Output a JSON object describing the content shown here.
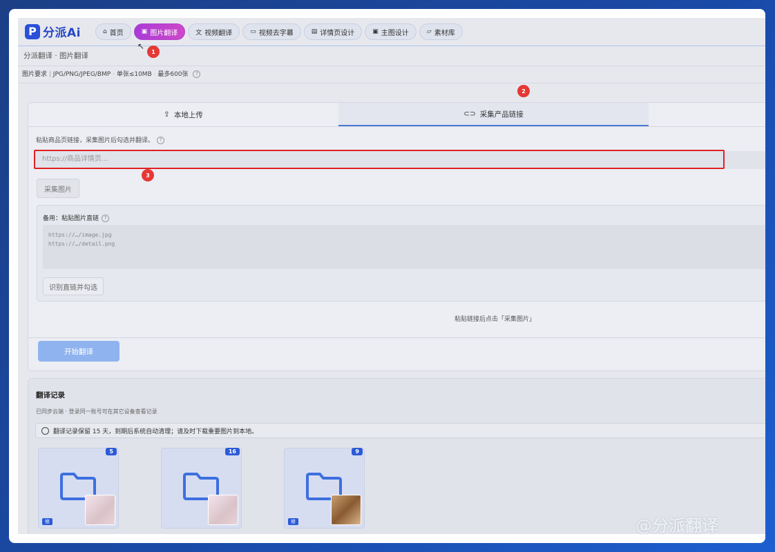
{
  "app": {
    "logo_text": "分派Ai"
  },
  "nav": {
    "tabs": [
      {
        "label": "首页",
        "icon": "home-icon"
      },
      {
        "label": "图片翻译",
        "icon": "image-icon",
        "active": true
      },
      {
        "label": "视频翻译",
        "icon": "translate-icon"
      },
      {
        "label": "视频去字幕",
        "icon": "subtitle-icon"
      },
      {
        "label": "详情页设计",
        "icon": "layout-icon"
      },
      {
        "label": "主图设计",
        "icon": "image-icon"
      },
      {
        "label": "素材库",
        "icon": "folder-icon"
      }
    ]
  },
  "breadcrumb": "分派翻译 · 图片翻译",
  "requirements": {
    "label": "图片要求",
    "formats": "JPG/PNG/JPEG/BMP",
    "size": "单张≤10MB",
    "count": "最多600张"
  },
  "upload_tabs": [
    {
      "label": "本地上传",
      "icon": "upload-icon"
    },
    {
      "label": "采集产品链接",
      "icon": "link-icon",
      "active": true
    }
  ],
  "link_form": {
    "hint": "粘贴商品页链接，采集图片后勾选并翻译。",
    "url_placeholder": "https://商品详情页...",
    "collect_button": "采集图片",
    "backup_label": "备用：粘贴图片直链",
    "backup_placeholder_line1": "https://…/image.jpg",
    "backup_placeholder_line2": "https://…/detail.png",
    "recognize_button": "识别直链并勾选",
    "paste_note": "粘贴链接后点击「采集图片」"
  },
  "start_button": "开始翻译",
  "history": {
    "title": "翻译记录",
    "subtitle": "已同步云端 · 登录同一账号可在其它设备查看记录",
    "notice": "翻译记录保留 15 天，到期后系统自动清理；请及时下载重要图片到本地。",
    "folders": [
      {
        "count": "5",
        "tag": "修"
      },
      {
        "count": "16",
        "tag": ""
      },
      {
        "count": "9",
        "tag": "修"
      }
    ]
  },
  "annotations": [
    "1",
    "2",
    "3"
  ],
  "watermark": "@分派翻译",
  "colors": {
    "accent": "#2b5bd6",
    "active_tab": "#b040d0",
    "marker": "#e53935"
  }
}
